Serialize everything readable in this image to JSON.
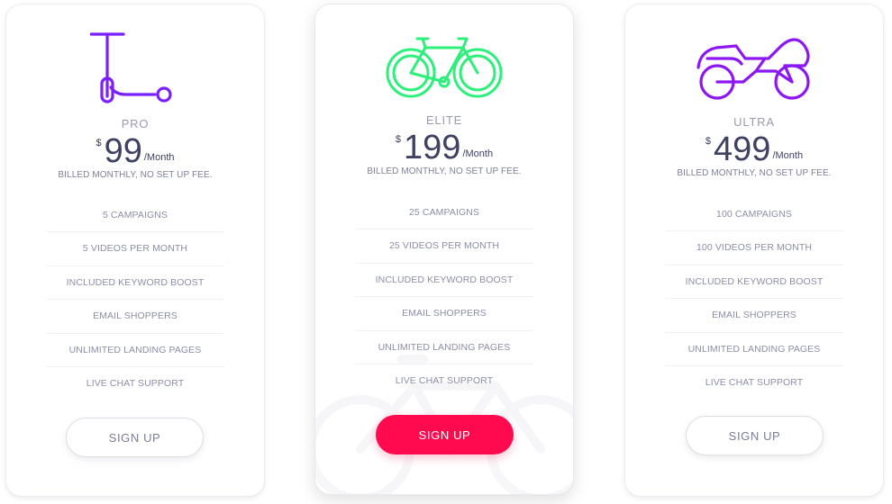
{
  "accent_colors": {
    "pro_icon": "#7a1fff",
    "elite_icon": "#2cf07a",
    "ultra_icon": "#8d16f5",
    "primary_button": "#ff0a4f"
  },
  "plans": [
    {
      "icon": "scooter-icon",
      "name": "PRO",
      "currency": "$",
      "price": "99",
      "period": "/Month",
      "billing": "BILLED MONTHLY, NO SET UP FEE.",
      "features": [
        "5 CAMPAIGNS",
        "5 VIDEOS PER MONTH",
        "INCLUDED KEYWORD BOOST",
        "EMAIL SHOPPERS",
        "UNLIMITED LANDING PAGES",
        "LIVE CHAT SUPPORT"
      ],
      "button_label": "SIGN UP"
    },
    {
      "icon": "bicycle-icon",
      "name": "ELITE",
      "currency": "$",
      "price": "199",
      "period": "/Month",
      "billing": "BILLED MONTHLY, NO SET UP FEE.",
      "features": [
        "25 CAMPAIGNS",
        "25 VIDEOS PER MONTH",
        "INCLUDED KEYWORD BOOST",
        "EMAIL SHOPPERS",
        "UNLIMITED LANDING PAGES",
        "LIVE CHAT SUPPORT"
      ],
      "button_label": "SIGN UP"
    },
    {
      "icon": "motorcycle-icon",
      "name": "ULTRA",
      "currency": "$",
      "price": "499",
      "period": "/Month",
      "billing": "BILLED MONTHLY, NO SET UP FEE.",
      "features": [
        "100 CAMPAIGNS",
        "100 VIDEOS PER MONTH",
        "INCLUDED KEYWORD BOOST",
        "EMAIL SHOPPERS",
        "UNLIMITED LANDING PAGES",
        "LIVE CHAT SUPPORT"
      ],
      "button_label": "SIGN UP"
    }
  ]
}
